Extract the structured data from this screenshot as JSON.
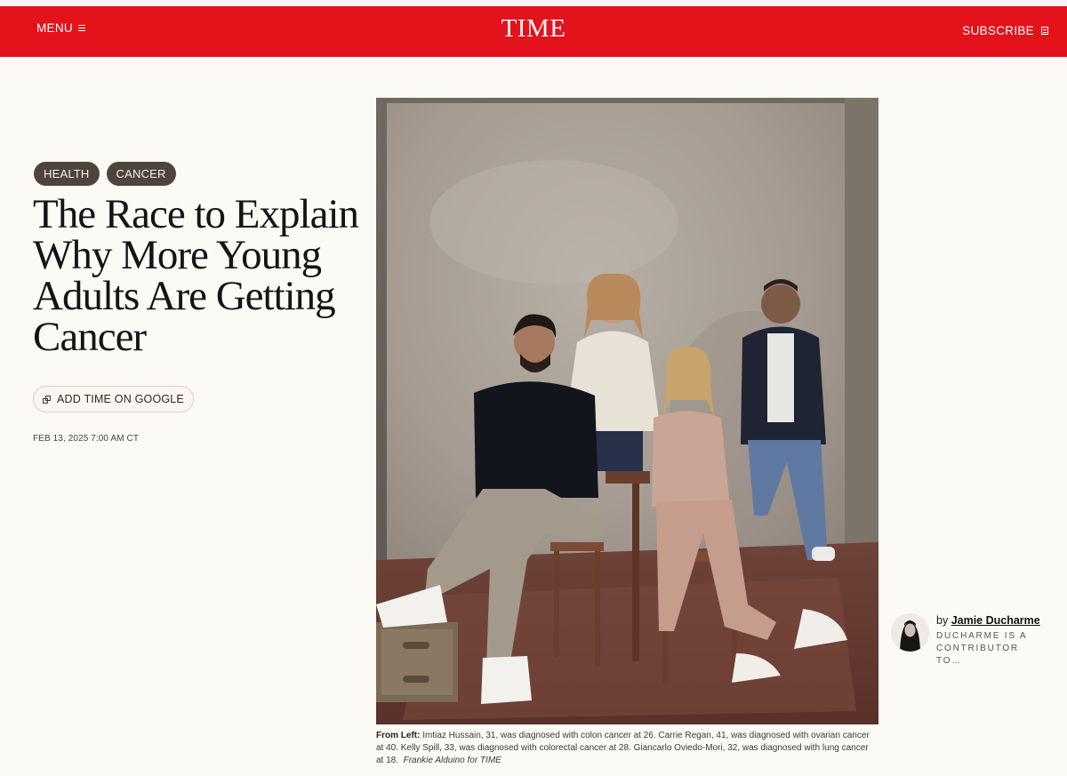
{
  "header": {
    "menu_label": "MENU",
    "logo_text": "TIME",
    "subscribe_label": "SUBSCRIBE",
    "brand_color": "#e3121b"
  },
  "article": {
    "tags": [
      "HEALTH",
      "CANCER"
    ],
    "headline": "The Race to Explain Why More Young Adults Are Getting Cancer",
    "google_button_label": "ADD TIME ON GOOGLE",
    "date": "FEB 13, 2025 7:00 AM CT"
  },
  "photo": {
    "caption_lead": "From Left:",
    "caption_text": " Imtiaz Hussain, 31, was diagnosed with colon cancer at 26. Carrie Regan, 41, was diagnosed with ovarian cancer at 40. Kelly Spill, 33, was diagnosed with colorectal cancer at 28. Giancarlo Oviedo-Mori, 32, was diagnosed with lung cancer at 18.",
    "credit": "Frankie Alduino for TIME"
  },
  "author": {
    "by": "by",
    "name": "Jamie Ducharme",
    "bio": "DUCHARME IS A CONTRIBUTOR TO…"
  }
}
